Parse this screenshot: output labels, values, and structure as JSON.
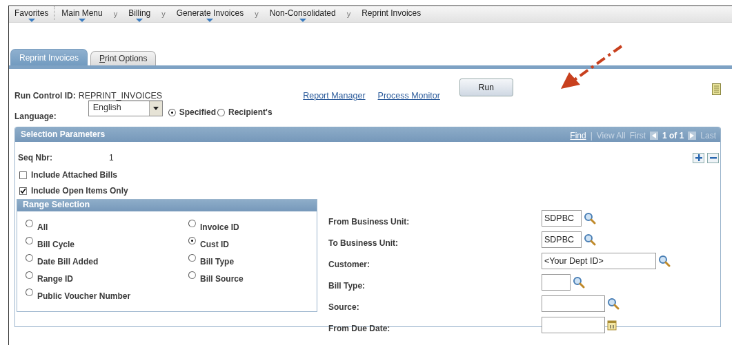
{
  "menu": [
    {
      "kind": "item",
      "label": "Favorites",
      "dropdown": true
    },
    {
      "kind": "item",
      "label": "Main Menu",
      "dropdown": true
    },
    {
      "kind": "separator",
      "label": "y"
    },
    {
      "kind": "item",
      "label": "Billing",
      "dropdown": true
    },
    {
      "kind": "separator",
      "label": "y"
    },
    {
      "kind": "item",
      "label": "Generate Invoices",
      "dropdown": true
    },
    {
      "kind": "separator",
      "label": "y"
    },
    {
      "kind": "item",
      "label": "Non-Consolidated",
      "dropdown": true
    },
    {
      "kind": "separator",
      "label": "y"
    },
    {
      "kind": "item",
      "label": "Reprint Invoices",
      "dropdown": false
    }
  ],
  "tabs": [
    {
      "label": "Reprint Invoices",
      "selected": true
    },
    {
      "label": "Print Options",
      "selected": false
    }
  ],
  "run_control": {
    "label": "Run Control ID:",
    "value": "REPRINT_INVOICES"
  },
  "links": [
    "Report Manager",
    "Process Monitor"
  ],
  "run_button": "Run",
  "language": {
    "label": "Language:",
    "value": "English",
    "options": [
      {
        "label": "Specified",
        "selected": true
      },
      {
        "label": "Recipient's",
        "selected": false
      }
    ]
  },
  "selection": {
    "title": "Selection Parameters",
    "nav": {
      "find": "Find",
      "separator": "|",
      "view_all": "View All",
      "first": "First",
      "count": "1 of 1",
      "last": "Last"
    },
    "seq": {
      "label": "Seq Nbr:",
      "value": "1"
    },
    "checkboxes": [
      {
        "label": "Include Attached Bills",
        "checked": false
      },
      {
        "label": "Include Open Items Only",
        "checked": true
      }
    ],
    "range": {
      "title": "Range Selection",
      "columns": [
        [
          {
            "label": "All",
            "selected": false
          },
          {
            "label": "Bill Cycle",
            "selected": false
          },
          {
            "label": "Date Bill Added",
            "selected": false
          },
          {
            "label": "Range ID",
            "selected": false
          },
          {
            "label": "Public Voucher Number",
            "selected": false
          }
        ],
        [
          {
            "label": "Invoice ID",
            "selected": false
          },
          {
            "label": "Cust ID",
            "selected": true
          },
          {
            "label": "Bill Type",
            "selected": false
          },
          {
            "label": "Bill Source",
            "selected": false
          }
        ]
      ]
    },
    "fields": [
      {
        "label": "From Business Unit:",
        "value": "SDPBC",
        "kind": "lookup"
      },
      {
        "label": "To Business Unit:",
        "value": "SDPBC",
        "kind": "lookup"
      },
      {
        "label": "Customer:",
        "value": "<Your Dept ID>",
        "kind": "lookup"
      },
      {
        "label": "Bill Type:",
        "kind": "lookup"
      },
      {
        "label": "Source:",
        "kind": "lookup"
      },
      {
        "label": "From Due Date:",
        "kind": "date"
      }
    ]
  }
}
